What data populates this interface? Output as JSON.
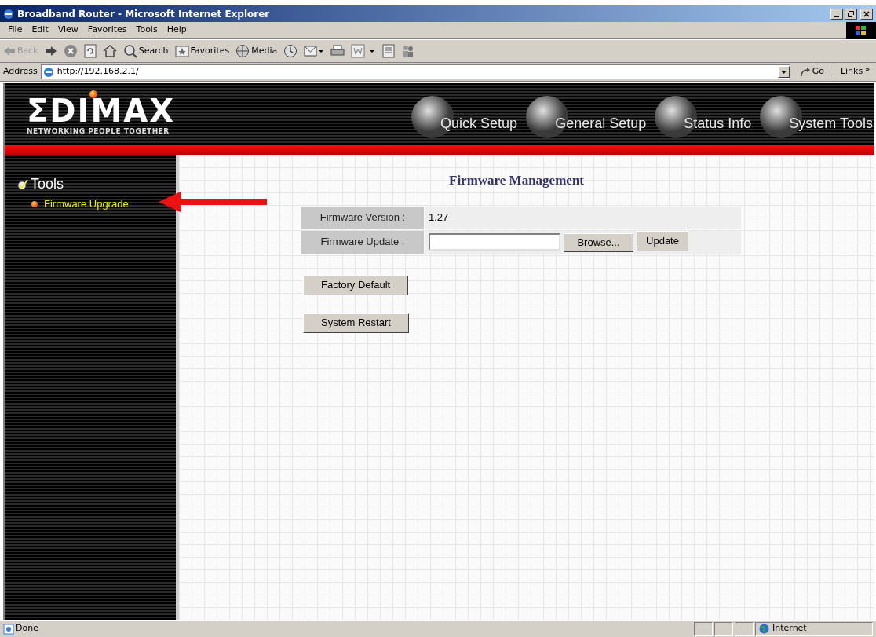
{
  "window": {
    "title": "Broadband Router - Microsoft Internet Explorer"
  },
  "menu": [
    "File",
    "Edit",
    "View",
    "Favorites",
    "Tools",
    "Help"
  ],
  "toolbar": [
    {
      "kind": "back",
      "label": "Back",
      "disabled": true
    },
    {
      "kind": "forward",
      "disabled": false
    },
    {
      "kind": "stop"
    },
    {
      "kind": "refresh"
    },
    {
      "kind": "home"
    },
    {
      "kind": "search",
      "label": "Search"
    },
    {
      "kind": "favorites",
      "label": "Favorites"
    },
    {
      "kind": "media",
      "label": "Media"
    },
    {
      "kind": "history"
    },
    {
      "kind": "mail"
    },
    {
      "kind": "print"
    },
    {
      "kind": "edit"
    },
    {
      "kind": "discuss"
    },
    {
      "kind": "messenger"
    }
  ],
  "address": {
    "label": "Address",
    "value": "http://192.168.2.1/",
    "go": "Go",
    "links": "Links",
    "links_chevron": "»"
  },
  "brand": {
    "logo": "ΣDIMAX",
    "tagline": "NETWORKING PEOPLE TOGETHER"
  },
  "nav": [
    "Quick Setup",
    "General Setup",
    "Status Info",
    "System Tools"
  ],
  "sidebar": {
    "heading": "Tools",
    "items": [
      {
        "label": "Firmware Upgrade",
        "selected": true
      }
    ]
  },
  "main": {
    "title": "Firmware Management",
    "rows": [
      {
        "kind": "text",
        "label": "Firmware Version :",
        "value": "1.27"
      },
      {
        "kind": "file",
        "label": "Firmware Update :",
        "browse": "Browse...",
        "button": "Update"
      }
    ],
    "buttons": [
      "Factory Default",
      "System Restart"
    ]
  },
  "status_bar": {
    "text": "Done",
    "zone": "Internet"
  }
}
